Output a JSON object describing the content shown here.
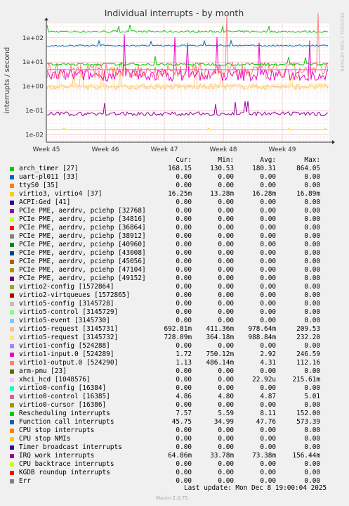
{
  "chart_data": {
    "type": "line",
    "title": "Individual interrupts - by month",
    "ylabel": "interrupts / second",
    "xlabel": "",
    "watermark": "RRDTOOL / TOBI OETIKER",
    "y_scale": "log",
    "ylim": [
      0.005,
      400
    ],
    "y_ticks": [
      "1e-02",
      "1e-01",
      "1e+00",
      "1e+01",
      "1e+02"
    ],
    "x_ticks": [
      "Week 45",
      "Week 46",
      "Week 47",
      "Week 48",
      "Week 49"
    ],
    "grid": true,
    "columns": [
      "Cur:",
      "Min:",
      "Avg:",
      "Max:"
    ],
    "series": [
      {
        "name": "arch_timer [27]",
        "color": "#00cc00",
        "cur": "168.15",
        "min": "130.53",
        "avg": "180.31",
        "max": "864.05"
      },
      {
        "name": "uart-pl011 [33]",
        "color": "#0066b3",
        "cur": "0.00",
        "min": "0.00",
        "avg": "0.00",
        "max": "0.00"
      },
      {
        "name": "ttyS0 [35]",
        "color": "#ff8000",
        "cur": "0.00",
        "min": "0.00",
        "avg": "0.00",
        "max": "0.00"
      },
      {
        "name": "virtio3, virtio4 [37]",
        "color": "#ffcc00",
        "cur": "16.25m",
        "min": "13.28m",
        "avg": "16.28m",
        "max": "16.89m"
      },
      {
        "name": "ACPI:Ged [41]",
        "color": "#330099",
        "cur": "0.00",
        "min": "0.00",
        "avg": "0.00",
        "max": "0.00"
      },
      {
        "name": "PCIe PME, aerdrv, pciehp [32768]",
        "color": "#990099",
        "cur": "0.00",
        "min": "0.00",
        "avg": "0.00",
        "max": "0.00"
      },
      {
        "name": "PCIe PME, aerdrv, pciehp [34816]",
        "color": "#ccff00",
        "cur": "0.00",
        "min": "0.00",
        "avg": "0.00",
        "max": "0.00"
      },
      {
        "name": "PCIe PME, aerdrv, pciehp [36864]",
        "color": "#ff0000",
        "cur": "0.00",
        "min": "0.00",
        "avg": "0.00",
        "max": "0.00"
      },
      {
        "name": "PCIe PME, aerdrv, pciehp [38912]",
        "color": "#808080",
        "cur": "0.00",
        "min": "0.00",
        "avg": "0.00",
        "max": "0.00"
      },
      {
        "name": "PCIe PME, aerdrv, pciehp [40960]",
        "color": "#008f00",
        "cur": "0.00",
        "min": "0.00",
        "avg": "0.00",
        "max": "0.00"
      },
      {
        "name": "PCIe PME, aerdrv, pciehp [43008]",
        "color": "#00487d",
        "cur": "0.00",
        "min": "0.00",
        "avg": "0.00",
        "max": "0.00"
      },
      {
        "name": "PCIe PME, aerdrv, pciehp [45056]",
        "color": "#b35a00",
        "cur": "0.00",
        "min": "0.00",
        "avg": "0.00",
        "max": "0.00"
      },
      {
        "name": "PCIe PME, aerdrv, pciehp [47104]",
        "color": "#b38f00",
        "cur": "0.00",
        "min": "0.00",
        "avg": "0.00",
        "max": "0.00"
      },
      {
        "name": "PCIe PME, aerdrv, pciehp [49152]",
        "color": "#6b006b",
        "cur": "0.00",
        "min": "0.00",
        "avg": "0.00",
        "max": "0.00"
      },
      {
        "name": "virtio2-config [1572864]",
        "color": "#8fb300",
        "cur": "0.00",
        "min": "0.00",
        "avg": "0.00",
        "max": "0.00"
      },
      {
        "name": "virtio2-virtqueues [1572865]",
        "color": "#b30000",
        "cur": "0.00",
        "min": "0.00",
        "avg": "0.00",
        "max": "0.00"
      },
      {
        "name": "virtio5-config [3145728]",
        "color": "#bebebe",
        "cur": "0.00",
        "min": "0.00",
        "avg": "0.00",
        "max": "0.00"
      },
      {
        "name": "virtio5-control [3145729]",
        "color": "#80ff80",
        "cur": "0.00",
        "min": "0.00",
        "avg": "0.00",
        "max": "0.00"
      },
      {
        "name": "virtio5-event [3145730]",
        "color": "#80c9ff",
        "cur": "0.00",
        "min": "0.00",
        "avg": "0.00",
        "max": "0.00"
      },
      {
        "name": "virtio5-request [3145731]",
        "color": "#ffc080",
        "cur": "692.81m",
        "min": "411.36m",
        "avg": "978.64m",
        "max": "209.53"
      },
      {
        "name": "virtio5-request [3145732]",
        "color": "#ffe680",
        "cur": "728.09m",
        "min": "364.18m",
        "avg": "988.84m",
        "max": "232.20"
      },
      {
        "name": "virtio1-config [524288]",
        "color": "#aa80ff",
        "cur": "0.00",
        "min": "0.00",
        "avg": "0.00",
        "max": "0.00"
      },
      {
        "name": "virtio1-input.0 [524289]",
        "color": "#ee00cc",
        "cur": "1.72",
        "min": "750.12m",
        "avg": "2.92",
        "max": "246.59"
      },
      {
        "name": "virtio1-output.0 [524290]",
        "color": "#ff8080",
        "cur": "1.13",
        "min": "486.14m",
        "avg": "4.31",
        "max": "112.16"
      },
      {
        "name": "arm-pmu [23]",
        "color": "#666600",
        "cur": "0.00",
        "min": "0.00",
        "avg": "0.00",
        "max": "0.00"
      },
      {
        "name": "xhci_hcd [1048576]",
        "color": "#ffbfff",
        "cur": "0.00",
        "min": "0.00",
        "avg": "22.92u",
        "max": "215.61m"
      },
      {
        "name": "virtio0-config [16384]",
        "color": "#00ffcc",
        "cur": "0.00",
        "min": "0.00",
        "avg": "0.00",
        "max": "0.00"
      },
      {
        "name": "virtio0-control [16385]",
        "color": "#cc6699",
        "cur": "4.86",
        "min": "4.80",
        "avg": "4.87",
        "max": "5.01"
      },
      {
        "name": "virtio0-cursor [16386]",
        "color": "#999900",
        "cur": "0.00",
        "min": "0.00",
        "avg": "0.00",
        "max": "0.00"
      },
      {
        "name": "Rescheduling interrupts",
        "color": "#00cc00",
        "cur": "7.57",
        "min": "5.59",
        "avg": "8.11",
        "max": "152.00"
      },
      {
        "name": "Function call interrupts",
        "color": "#0066b3",
        "cur": "45.75",
        "min": "34.99",
        "avg": "47.76",
        "max": "573.39"
      },
      {
        "name": "CPU stop interrupts",
        "color": "#ff8000",
        "cur": "0.00",
        "min": "0.00",
        "avg": "0.00",
        "max": "0.00"
      },
      {
        "name": "CPU stop NMIs",
        "color": "#ffcc00",
        "cur": "0.00",
        "min": "0.00",
        "avg": "0.00",
        "max": "0.00"
      },
      {
        "name": "Timer broadcast interrupts",
        "color": "#330099",
        "cur": "0.00",
        "min": "0.00",
        "avg": "0.00",
        "max": "0.00"
      },
      {
        "name": "IRQ work interrupts",
        "color": "#990099",
        "cur": "64.86m",
        "min": "33.78m",
        "avg": "73.38m",
        "max": "156.44m"
      },
      {
        "name": "CPU backtrace interrupts",
        "color": "#ccff00",
        "cur": "0.00",
        "min": "0.00",
        "avg": "0.00",
        "max": "0.00"
      },
      {
        "name": "KGDB roundup interrupts",
        "color": "#ff0000",
        "cur": "0.00",
        "min": "0.00",
        "avg": "0.00",
        "max": "0.00"
      },
      {
        "name": "Err",
        "color": "#808080",
        "cur": "0.00",
        "min": "0.00",
        "avg": "0.00",
        "max": "0.00"
      }
    ],
    "footer": "Last update: Mon Dec  8 19:00:04 2025",
    "generator": "Munin 2.0.75"
  }
}
